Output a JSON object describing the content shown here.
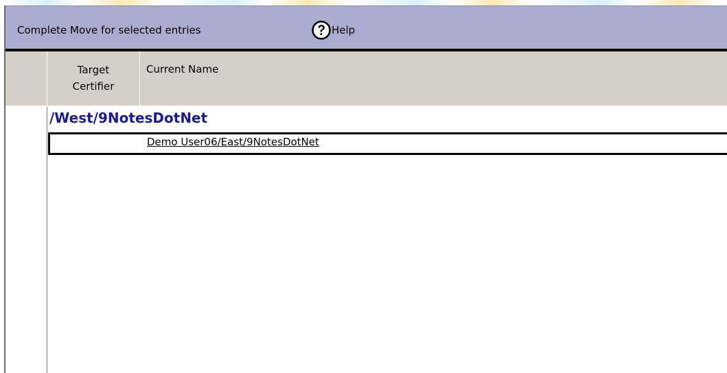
{
  "action_bar": {
    "complete_move_label": "Complete Move for selected entries",
    "help_label": "Help",
    "help_icon": "question-circle-icon",
    "background_color": "#acacd0"
  },
  "columns": {
    "target_certifier_line1": "Target",
    "target_certifier_line2": "Certifier",
    "current_name": "Current Name"
  },
  "view": {
    "category": "/West/9NotesDotNet",
    "category_color": "#1c1c8c",
    "rows": [
      {
        "target_certifier": "",
        "current_name": "Demo User06/East/9NotesDotNet"
      }
    ]
  }
}
